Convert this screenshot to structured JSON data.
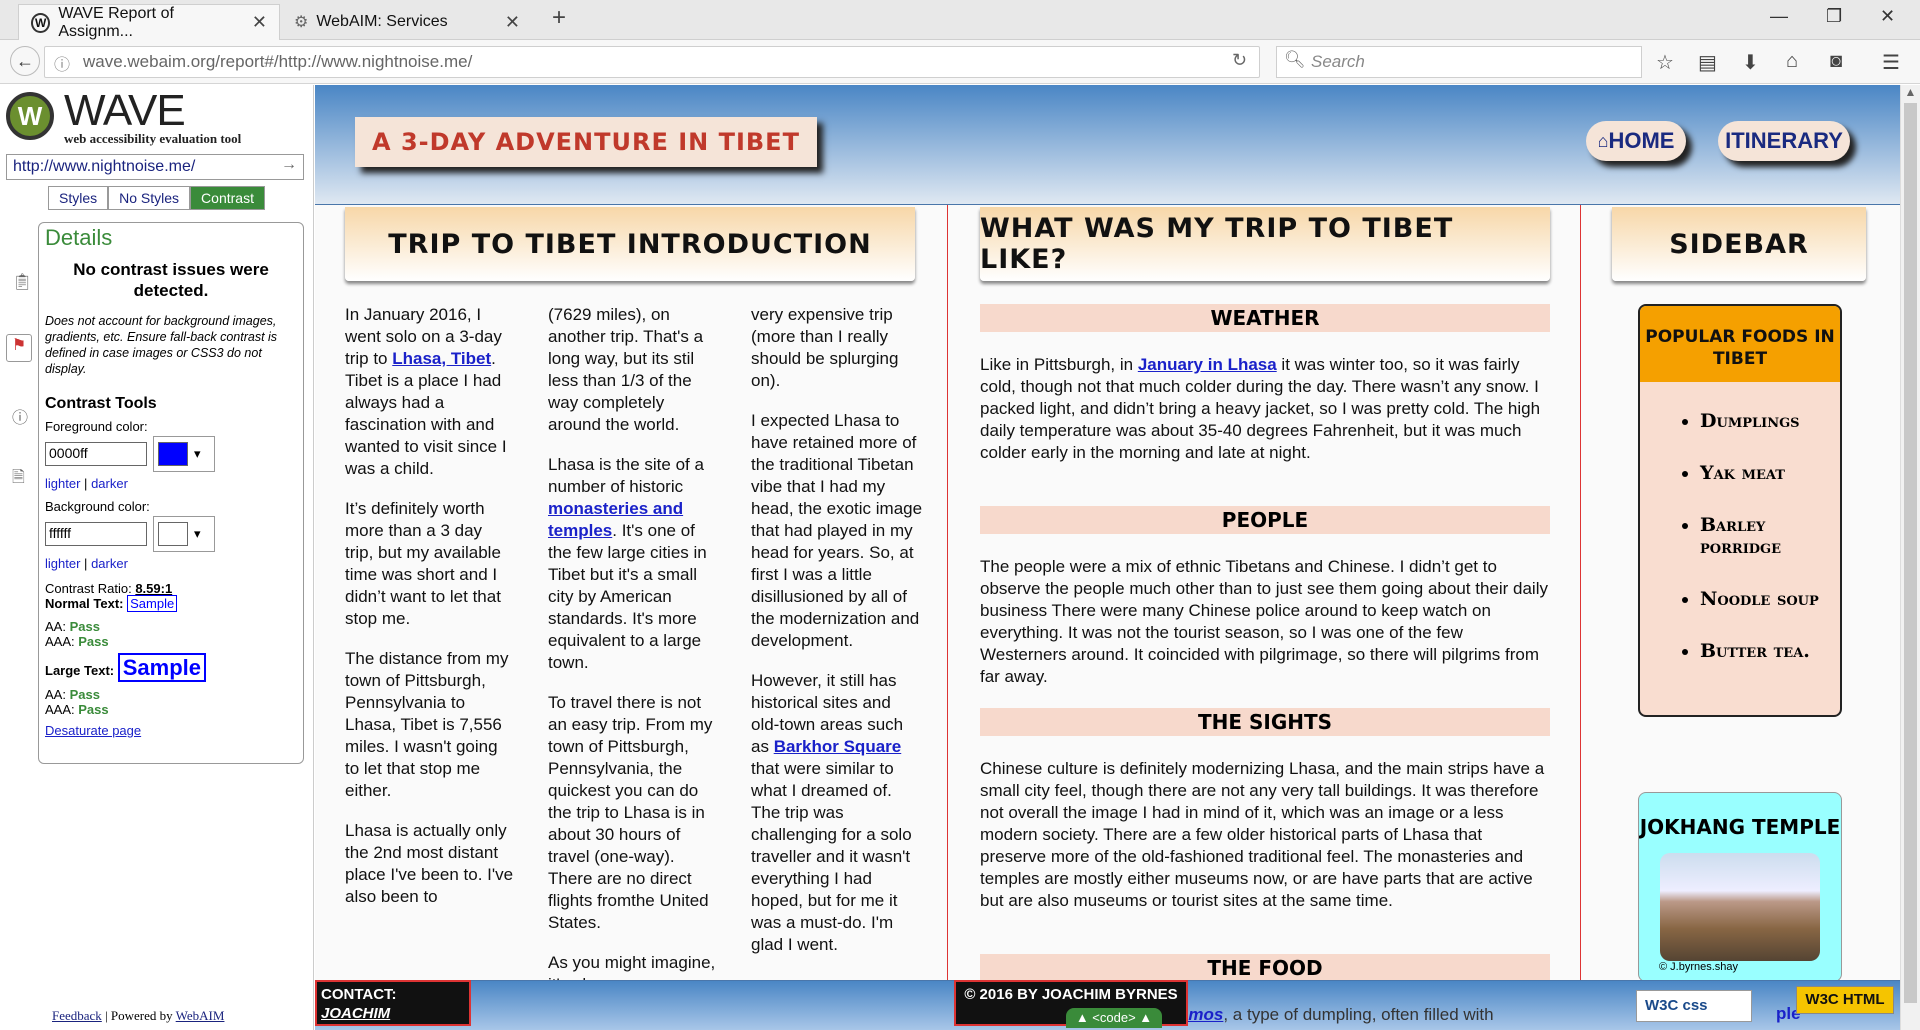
{
  "browser": {
    "tabs": [
      {
        "title": "WAVE Report of Assignm..."
      },
      {
        "title": "WebAIM: Services"
      }
    ],
    "new_tab": "+",
    "url": "wave.webaim.org/report#/http://www.nightnoise.me/",
    "search_placeholder": "Search"
  },
  "wave": {
    "logo_text": "WAVE",
    "logo_sub": "web accessibility evaluation tool",
    "url": "http://www.nightnoise.me/",
    "view_tabs": [
      "Styles",
      "No Styles",
      "Contrast"
    ],
    "details_title": "Details",
    "no_issues": "No contrast issues were detected.",
    "note": "Does not account for background images, gradients, etc. Ensure fall-back contrast is defined in case images or CSS3 do not display.",
    "tools_title": "Contrast Tools",
    "fg_label": "Foreground color:",
    "fg_value": "0000ff",
    "bg_label": "Background color:",
    "bg_value": "ffffff",
    "lighter": "lighter",
    "darker": "darker",
    "sep": "|",
    "ratio_label": "Contrast Ratio:",
    "ratio_value": "8.59:1",
    "normal_label": "Normal Text:",
    "large_label": "Large Text:",
    "sample": "Sample",
    "aa": "AA:",
    "aaa": "AAA:",
    "pass": "Pass",
    "desaturate": "Desaturate page",
    "feedback": "Feedback",
    "powered": "| Powered by",
    "webaim": "WebAIM",
    "fg_color": "#0000ff",
    "bg_color": "#ffffff"
  },
  "site": {
    "title": "A 3-DAY ADVENTURE IN TIBET",
    "nav": [
      "HOME",
      "ITINERARY"
    ],
    "intro_heading": "TRIP TO TIBET INTRODUCTION",
    "trip_heading": "WHAT WAS MY TRIP TO TIBET LIKE?",
    "sidebar_heading": "SIDEBAR",
    "intro_col1": [
      [
        "In January 2016, I went solo on a 3-day trip to ",
        "Lhasa, Tibet",
        ". Tibet is a place I had always had a fascination with and wanted to visit since I was a child."
      ],
      [
        "It’s definitely worth more than a 3 day trip, but my available time was short and I didn’t want to let that stop me.",
        "",
        ""
      ],
      [
        "The distance from my town of Pittsburgh, Pennsylvania to Lhasa, Tibet is 7,556 miles. I wasn't going to let that stop me either.",
        "",
        ""
      ],
      [
        "Lhasa is actually only the 2nd most distant place I've been to. I've also been to",
        "",
        ""
      ]
    ],
    "intro_col2": [
      [
        "(7629 miles), on another trip. That's a long way, but its stil less than 1/3 of the way completely around the world.",
        "",
        ""
      ],
      [
        "Lhasa is the site of a number of historic ",
        "monasteries and temples",
        ". It's one of the few large cities in Tibet but it's a small city by American standards. It's more equivalent to a large town."
      ],
      [
        "To travel there is not an easy trip. From my town of Pittsburgh, Pennsylvania, the quickest you can do the trip to Lhasa is in about 30 hours of travel (one-way). There are no direct flights fromthe United States.",
        "",
        ""
      ],
      [
        "As you might imagine, it's also a",
        "",
        ""
      ]
    ],
    "intro_col3": [
      [
        "very expensive trip (more than I really should be splurging on).",
        "",
        ""
      ],
      [
        "I expected Lhasa to have retained more of the traditional Tibetan vibe that I had my head, the exotic image that had played in my head for years. So, at first I was a little disillusioned by all of the modernization and development.",
        "",
        ""
      ],
      [
        "However, it still has historical sites and old-town areas such as ",
        "Barkhor Square",
        " that were similar to what I dreamed of. The trip was challenging for a solo traveller and it wasn't everything I had hoped, but for me it was a must-do. I'm glad I went."
      ]
    ],
    "sections": [
      {
        "heading": "WEATHER",
        "pre": "Like in Pittsburgh, in ",
        "link": "January in Lhasa",
        "post": " it was winter too, so it was fairly cold, though not that much colder during the day. There wasn’t any snow. I packed light, and didn’t bring a heavy jacket, so I was pretty cold. The high daily temperature was about 35-40 degrees Fahrenheit, but it was much colder early in the morning and late at night."
      },
      {
        "heading": "PEOPLE",
        "pre": "The people were a mix of ethnic Tibetans and Chinese. I didn’t get to observe the people much other than to just see them going about their daily business There were many Chinese police around to keep watch on everything. It was not the tourist season, so I was one of the few Westerners around. It coincided with pilgrimage, so there will pilgrims from far away.",
        "link": "",
        "post": ""
      },
      {
        "heading": "THE SIGHTS",
        "pre": "Chinese culture is definitely modernizing Lhasa, and the main strips have a small city feel, though there are not any very tall buildings. It was therefore not overall the image I had in mind of it, which was an image or a less modern society. There are a few older historical parts of Lhasa that preserve more of the old-fashioned traditional feel. The monasteries and temples are mostly either museums now, or are have parts that are active but are also museums or tourist sites at the same time.",
        "link": "",
        "post": ""
      },
      {
        "heading": "THE FOOD",
        "pre": "",
        "link": "",
        "post": ""
      }
    ],
    "food_partial": "omos",
    "food_partial_rest": ", a type of dumpling, often filled with",
    "foods_heading": "POPULAR FOODS IN TIBET",
    "foods": [
      "Dumplings",
      "Yak meat",
      "Barley porridge",
      "Noodle soup",
      "Butter tea."
    ],
    "jokhang_heading": "JOKHANG TEMPLE",
    "jokhang_caption": "© J.byrnes.shay",
    "jokhang_partial": "ple",
    "contact_label": "CONTACT:",
    "contact_name": "JOACHIM",
    "copyright": "© 2016 BY JOACHIM BYRNES",
    "code_toggle": "▲ <code> ▲",
    "w3c_css": "W3C css",
    "w3c_html": "W3C HTML"
  },
  "colors": {
    "accent_red": "#c0392b",
    "nav_blue": "#1a2a80",
    "wave_green": "#3a8b3a",
    "food_orange": "#f5a000"
  }
}
